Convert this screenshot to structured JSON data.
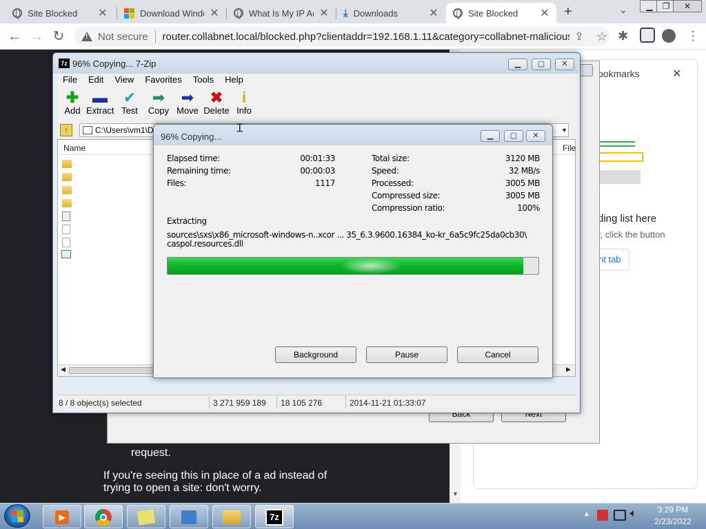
{
  "browser": {
    "tabs": [
      {
        "title": "Site Blocked",
        "icon": "globe-icon"
      },
      {
        "title": "Download Windo",
        "icon": "windows-logo-icon"
      },
      {
        "title": "What Is My IP Ad",
        "icon": "globe-icon"
      },
      {
        "title": "Downloads",
        "icon": "download-icon"
      },
      {
        "title": "Site Blocked",
        "icon": "globe-icon",
        "active": true
      }
    ],
    "not_secure": "Not secure",
    "url": "router.collabnet.local/blocked.php?clientaddr=192.168.1.11&category=collabnet-malicious&..."
  },
  "page": {
    "left_text_1": "request.",
    "left_text_2": "If you're seeing this in place of a ad instead of trying to open a site: don't worry.",
    "bg_dialog_buttons": {
      "back": "Back",
      "next": "Next"
    }
  },
  "bookmarks_panel": {
    "title": "ookmarks",
    "heading": "ding list here",
    "subtext": "r, click the button",
    "button": "nt tab"
  },
  "zip": {
    "title": "96% Copying... 7-Zip",
    "menu": [
      "File",
      "Edit",
      "View",
      "Favorites",
      "Tools",
      "Help"
    ],
    "tools": [
      {
        "label": "Add",
        "icon": "add-icon",
        "color": "#1aa31a"
      },
      {
        "label": "Extract",
        "icon": "extract-icon",
        "color": "#1c2fa0"
      },
      {
        "label": "Test",
        "icon": "test-icon",
        "color": "#19a7c0"
      },
      {
        "label": "Copy",
        "icon": "copy-icon",
        "color": "#2a8a6a"
      },
      {
        "label": "Move",
        "icon": "move-icon",
        "color": "#1c2fa0"
      },
      {
        "label": "Delete",
        "icon": "delete-icon",
        "color": "#d01010"
      },
      {
        "label": "Info",
        "icon": "info-icon",
        "color": "#d0b000"
      }
    ],
    "path": "C:\\Users\\vm1\\D",
    "col_name": "Name",
    "col_file": "File",
    "status": {
      "selected": "8 / 8 object(s) selected",
      "size": "3 271 959 189",
      "packed": "18 105 276",
      "date": "2014-11-21 01:33:07"
    }
  },
  "progress": {
    "title": "96% Copying...",
    "elapsed_label": "Elapsed time:",
    "elapsed": "00:01:33",
    "remaining_label": "Remaining time:",
    "remaining": "00:00:03",
    "files_label": "Files:",
    "files": "1117",
    "total_label": "Total size:",
    "total": "3120 MB",
    "speed_label": "Speed:",
    "speed": "32 MB/s",
    "processed_label": "Processed:",
    "processed": "3005 MB",
    "compressed_label": "Compressed size:",
    "compressed": "3005 MB",
    "ratio_label": "Compression ratio:",
    "ratio": "100%",
    "action": "Extracting",
    "file_line1": "sources\\sxs\\x86_microsoft-windows-n..xcor ... 35_6.3.9600.16384_ko-kr_6a5c9fc25da0cb30\\",
    "file_line2": "caspol.resources.dll",
    "percent": 96,
    "buttons": {
      "background": "Background",
      "pause": "Pause",
      "cancel": "Cancel"
    }
  },
  "taskbar": {
    "time": "3:29 PM",
    "date": "2/23/2022"
  }
}
